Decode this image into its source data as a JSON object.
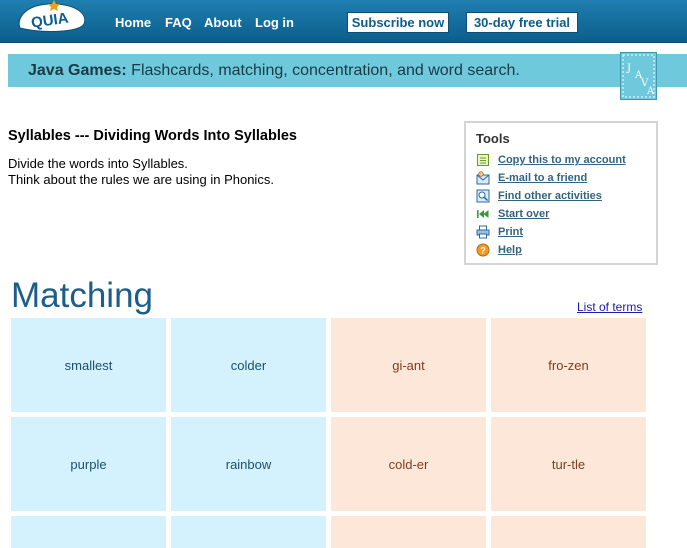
{
  "nav": {
    "logo_text": "QUIA",
    "links": [
      {
        "label": "Home"
      },
      {
        "label": "FAQ"
      },
      {
        "label": "About"
      },
      {
        "label": "Log in"
      }
    ],
    "subscribe_label": "Subscribe now",
    "trial_label": "30-day free trial"
  },
  "banner": {
    "bold": "Java Games:",
    "text": " Flashcards, matching, concentration, and word search.",
    "badge_letters": "JAVA"
  },
  "activity": {
    "title": "Syllables --- Dividing Words Into Syllables",
    "description_lines": [
      "Divide the words into Syllables.",
      "Think about the rules we are using in Phonics."
    ]
  },
  "tools": {
    "title": "Tools",
    "items": [
      {
        "label": "Copy this to my account",
        "icon": "copy-icon"
      },
      {
        "label": "E-mail to a friend",
        "icon": "email-icon"
      },
      {
        "label": "Find other activities",
        "icon": "search-icon"
      },
      {
        "label": "Start over",
        "icon": "rewind-icon"
      },
      {
        "label": "Print",
        "icon": "printer-icon"
      },
      {
        "label": "Help",
        "icon": "help-icon"
      }
    ]
  },
  "matching": {
    "heading": "Matching",
    "list_terms_label": "List of terms",
    "rows": [
      [
        {
          "text": "smallest",
          "color": "blue"
        },
        {
          "text": "colder",
          "color": "blue"
        },
        {
          "text": "gi-ant",
          "color": "peach"
        },
        {
          "text": "fro-zen",
          "color": "peach"
        }
      ],
      [
        {
          "text": "purple",
          "color": "blue"
        },
        {
          "text": "rainbow",
          "color": "blue"
        },
        {
          "text": "cold-er",
          "color": "peach"
        },
        {
          "text": "tur-tle",
          "color": "peach"
        }
      ],
      [
        {
          "text": "",
          "color": "blue"
        },
        {
          "text": "",
          "color": "blue"
        },
        {
          "text": "",
          "color": "peach"
        },
        {
          "text": "",
          "color": "peach"
        }
      ]
    ]
  },
  "colors": {
    "nav_bar": "#0b5e8c",
    "banner": "#6ec9dc",
    "card_blue": "#d4f2fd",
    "card_peach": "#fde7d8"
  }
}
